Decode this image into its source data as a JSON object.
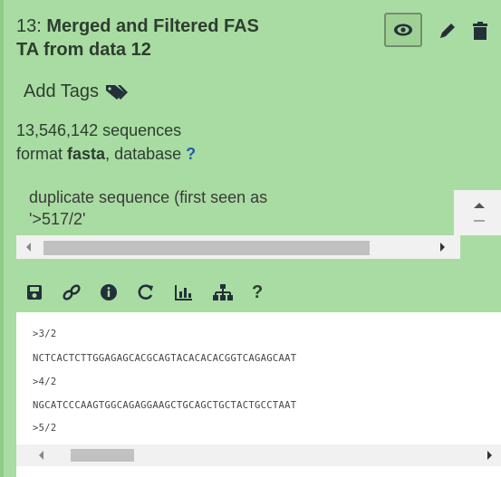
{
  "dataset": {
    "hid": "13:",
    "name": "Merged and Filtered FASTA from data 12",
    "name_line1": "Merged and Filtered FAS",
    "name_line2": "TA from data 12"
  },
  "tags": {
    "label": "Add Tags"
  },
  "summary": {
    "sequences": "13,546,142 sequences",
    "format_prefix": "format",
    "format_value": "fasta",
    "database_prefix": ",  database",
    "database_value": "?"
  },
  "info": {
    "line1": "duplicate sequence (first seen as",
    "line2": "'>517/2'"
  },
  "toolbar": {
    "help": "?"
  },
  "peek": [
    ">3/2",
    "NCTCACTCTTGGAGAGCACGCAGTACACACACGGTCAGAGCAAT",
    ">4/2",
    "NGCATCCCAAGTGGCAGAGGAAGCTGCAGCTGCTACTGCCTAAT",
    ">5/2"
  ],
  "colors": {
    "panel_bg": "#a9dca2",
    "text": "#2c3e2f",
    "question": "#2b5aa8"
  },
  "icons": [
    "eye-icon",
    "pencil-icon",
    "trash-icon",
    "tags-icon",
    "save-icon",
    "link-icon",
    "info-icon",
    "rerun-icon",
    "visualize-icon",
    "sitemap-icon"
  ]
}
